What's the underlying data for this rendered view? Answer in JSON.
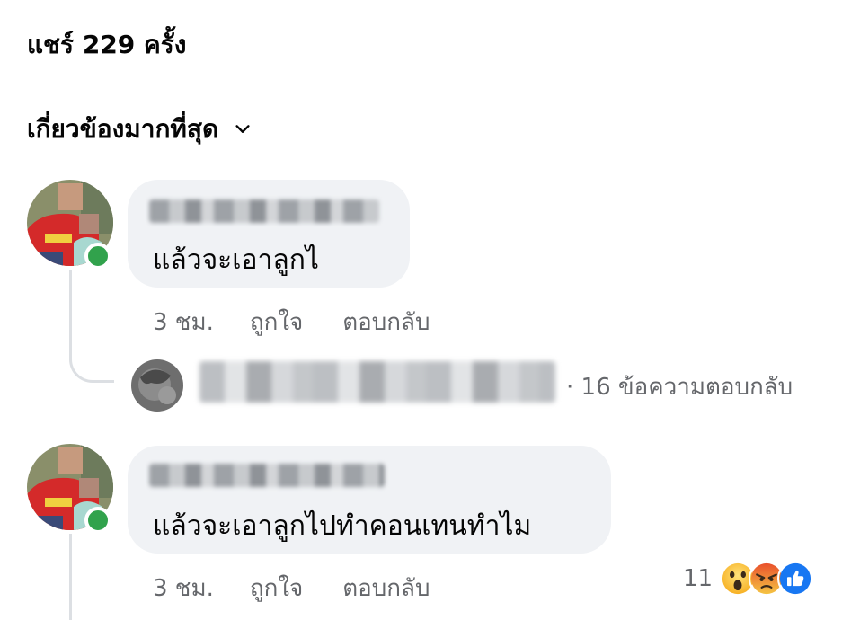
{
  "header": {
    "share_count": "แชร์ 229 ครั้ง",
    "sort_label": "เกี่ยวข้องมากที่สุด"
  },
  "comments": [
    {
      "text": "แล้วจะเอาลูกไ",
      "time": "3 ชม.",
      "like_label": "ถูกใจ",
      "reply_label": "ตอบกลับ"
    },
    {
      "text": "แล้วจะเอาลูกไปทำคอนเทนทำไม",
      "time": "3 ชม.",
      "like_label": "ถูกใจ",
      "reply_label": "ตอบกลับ",
      "reaction_count": "11",
      "reactions": [
        "wow-icon",
        "angry-icon",
        "like-icon"
      ]
    }
  ],
  "reply_summary": {
    "text": "· 16 ข้อความตอบกลับ"
  },
  "colors": {
    "bubble": "#f0f2f5",
    "online": "#31a24c",
    "secondary_text": "#65676b",
    "like_blue": "#1877f2"
  }
}
